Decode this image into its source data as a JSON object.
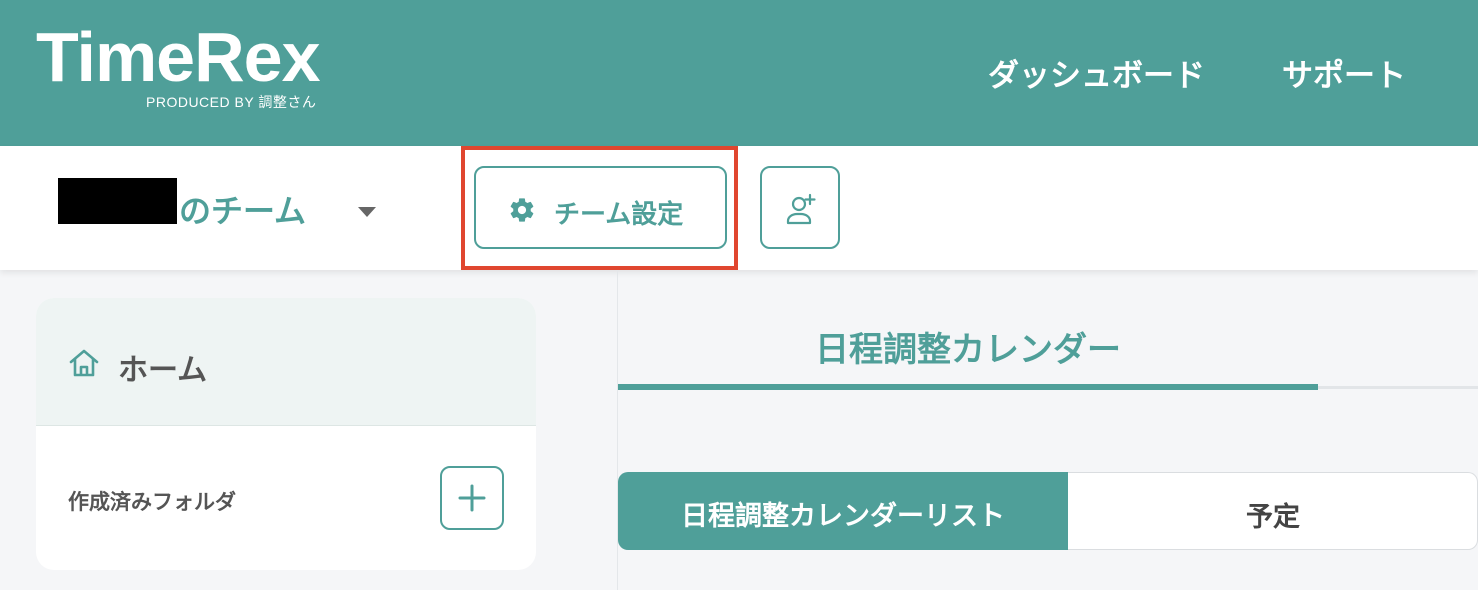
{
  "header": {
    "logo": "TimeRex",
    "logo_sub": "PRODUCED BY 調整さん",
    "nav": {
      "dashboard": "ダッシュボード",
      "support": "サポート"
    }
  },
  "teambar": {
    "team_name_suffix": "のチーム",
    "settings_label": "チーム設定"
  },
  "sidebar": {
    "home_label": "ホーム",
    "folder_label": "作成済みフォルダ"
  },
  "main": {
    "tab_title": "日程調整カレンダー",
    "segments": {
      "list": "日程調整カレンダーリスト",
      "schedule": "予定"
    }
  },
  "colors": {
    "brand": "#4f9f99",
    "highlight": "#e0462f"
  }
}
